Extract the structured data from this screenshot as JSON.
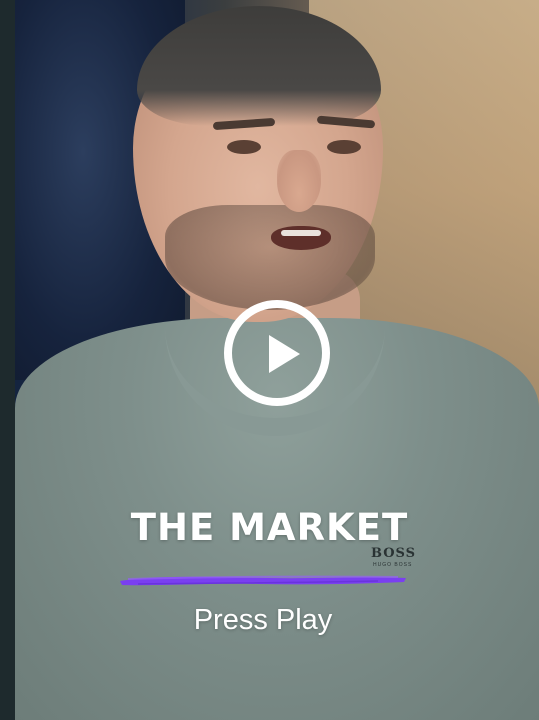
{
  "video": {
    "title": "THE MARKET",
    "subtitle": "Press Play",
    "shirt_logo": "BOSS",
    "shirt_logo_sub": "HUGO BOSS",
    "play_icon": "play-circle-icon",
    "accent_color": "#7a3ff0"
  }
}
